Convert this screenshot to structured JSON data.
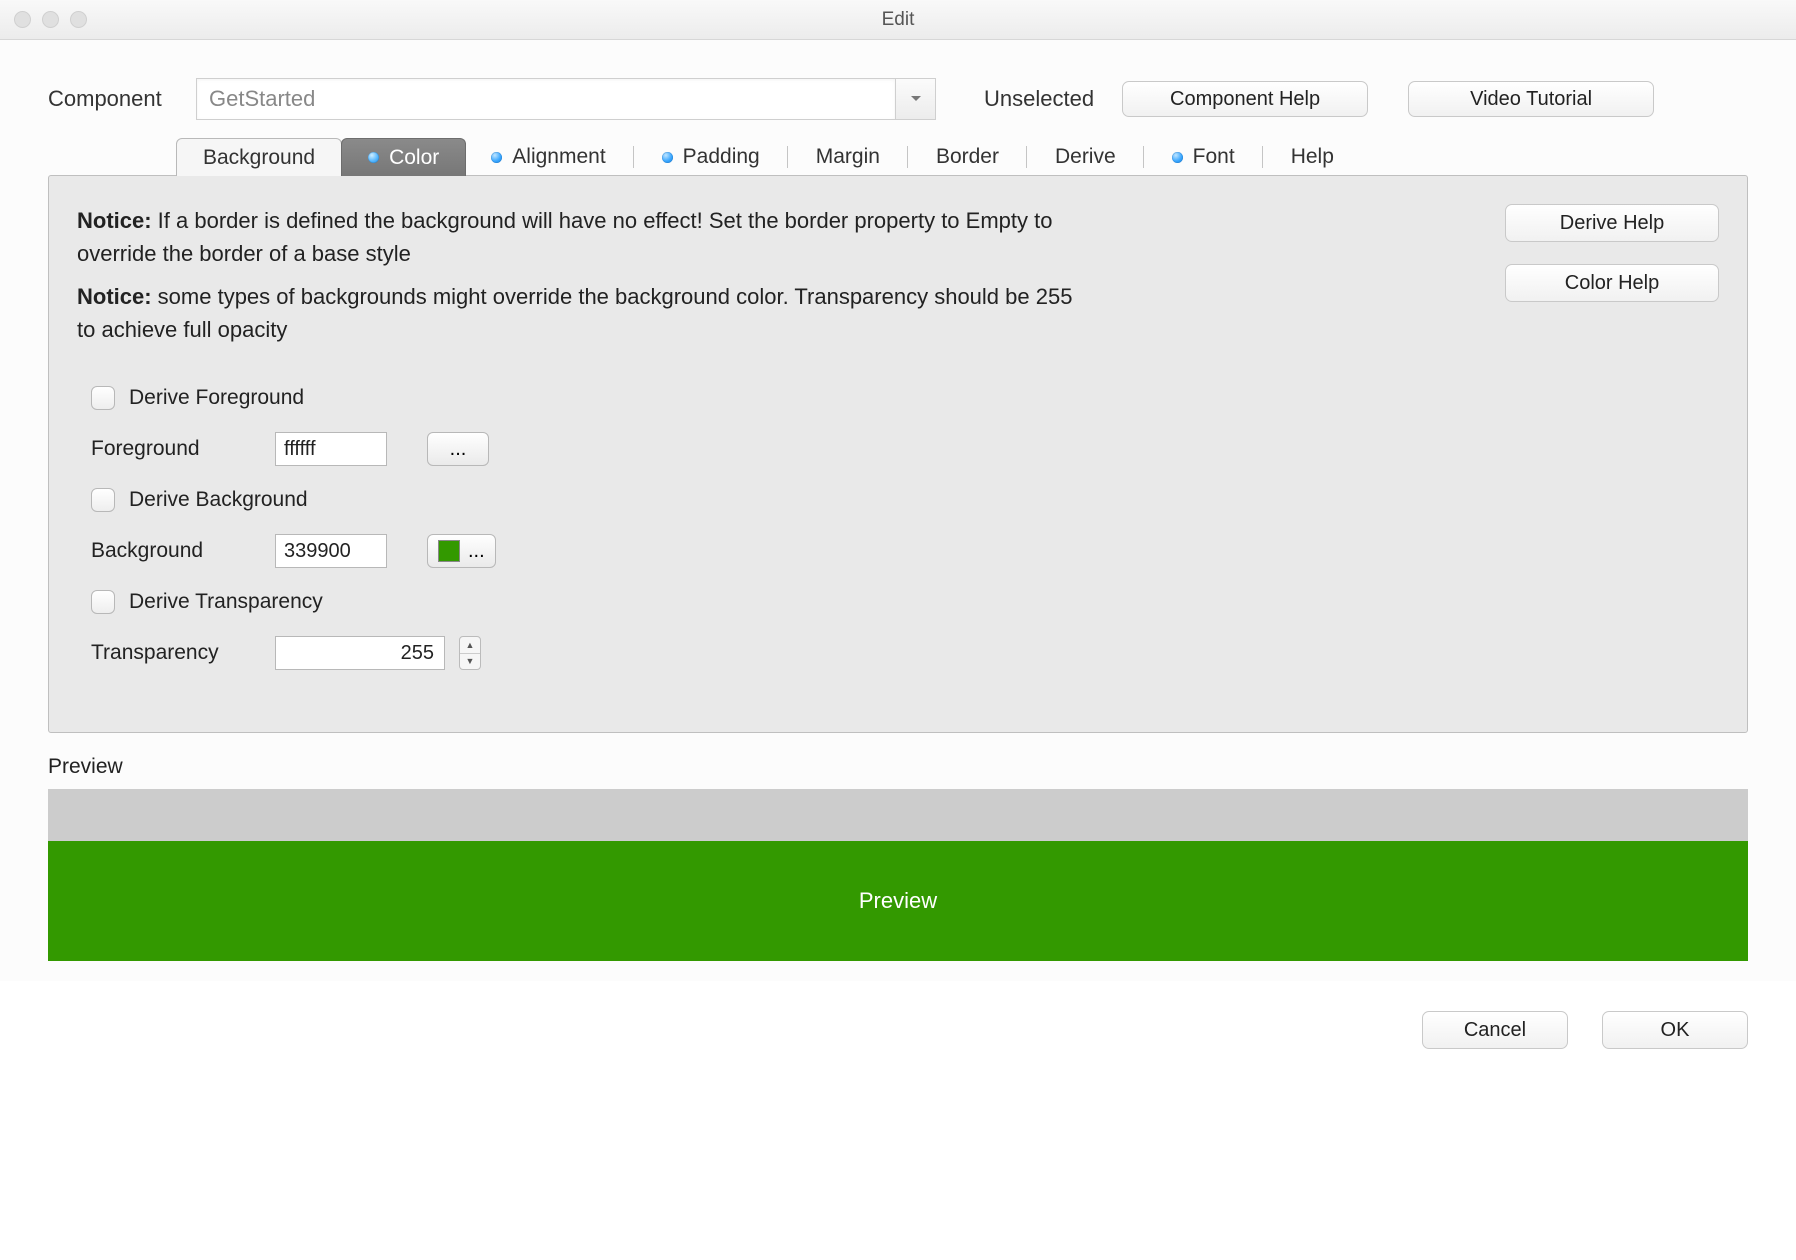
{
  "titlebar": {
    "title": "Edit"
  },
  "header": {
    "component_label": "Component",
    "component_value": "GetStarted",
    "unselected": "Unselected",
    "component_help": "Component Help",
    "video_tutorial": "Video Tutorial"
  },
  "tabs": {
    "background": "Background",
    "color": "Color",
    "alignment": "Alignment",
    "padding": "Padding",
    "margin": "Margin",
    "border": "Border",
    "derive": "Derive",
    "font": "Font",
    "help": "Help"
  },
  "notices": {
    "n1_bold": "Notice:",
    "n1_text": " If a border is defined the background will have no effect! Set the border property to Empty to override the border of a base style",
    "n2_bold": "Notice:",
    "n2_text": " some types of backgrounds might override the background color. Transparency should be 255 to achieve full opacity"
  },
  "help_buttons": {
    "derive_help": "Derive Help",
    "color_help": "Color Help"
  },
  "fields": {
    "derive_fg": "Derive Foreground",
    "foreground_label": "Foreground",
    "foreground_value": "ffffff",
    "fg_btn": "...",
    "derive_bg": "Derive Background",
    "background_label": "Background",
    "background_value": "339900",
    "bg_btn": "...",
    "derive_tr": "Derive Transparency",
    "transparency_label": "Transparency",
    "transparency_value": "255"
  },
  "colors": {
    "background_swatch": "#339900",
    "preview_bg": "#339900",
    "preview_fg": "#ffffff"
  },
  "preview": {
    "label": "Preview",
    "text": "Preview"
  },
  "footer": {
    "cancel": "Cancel",
    "ok": "OK"
  }
}
